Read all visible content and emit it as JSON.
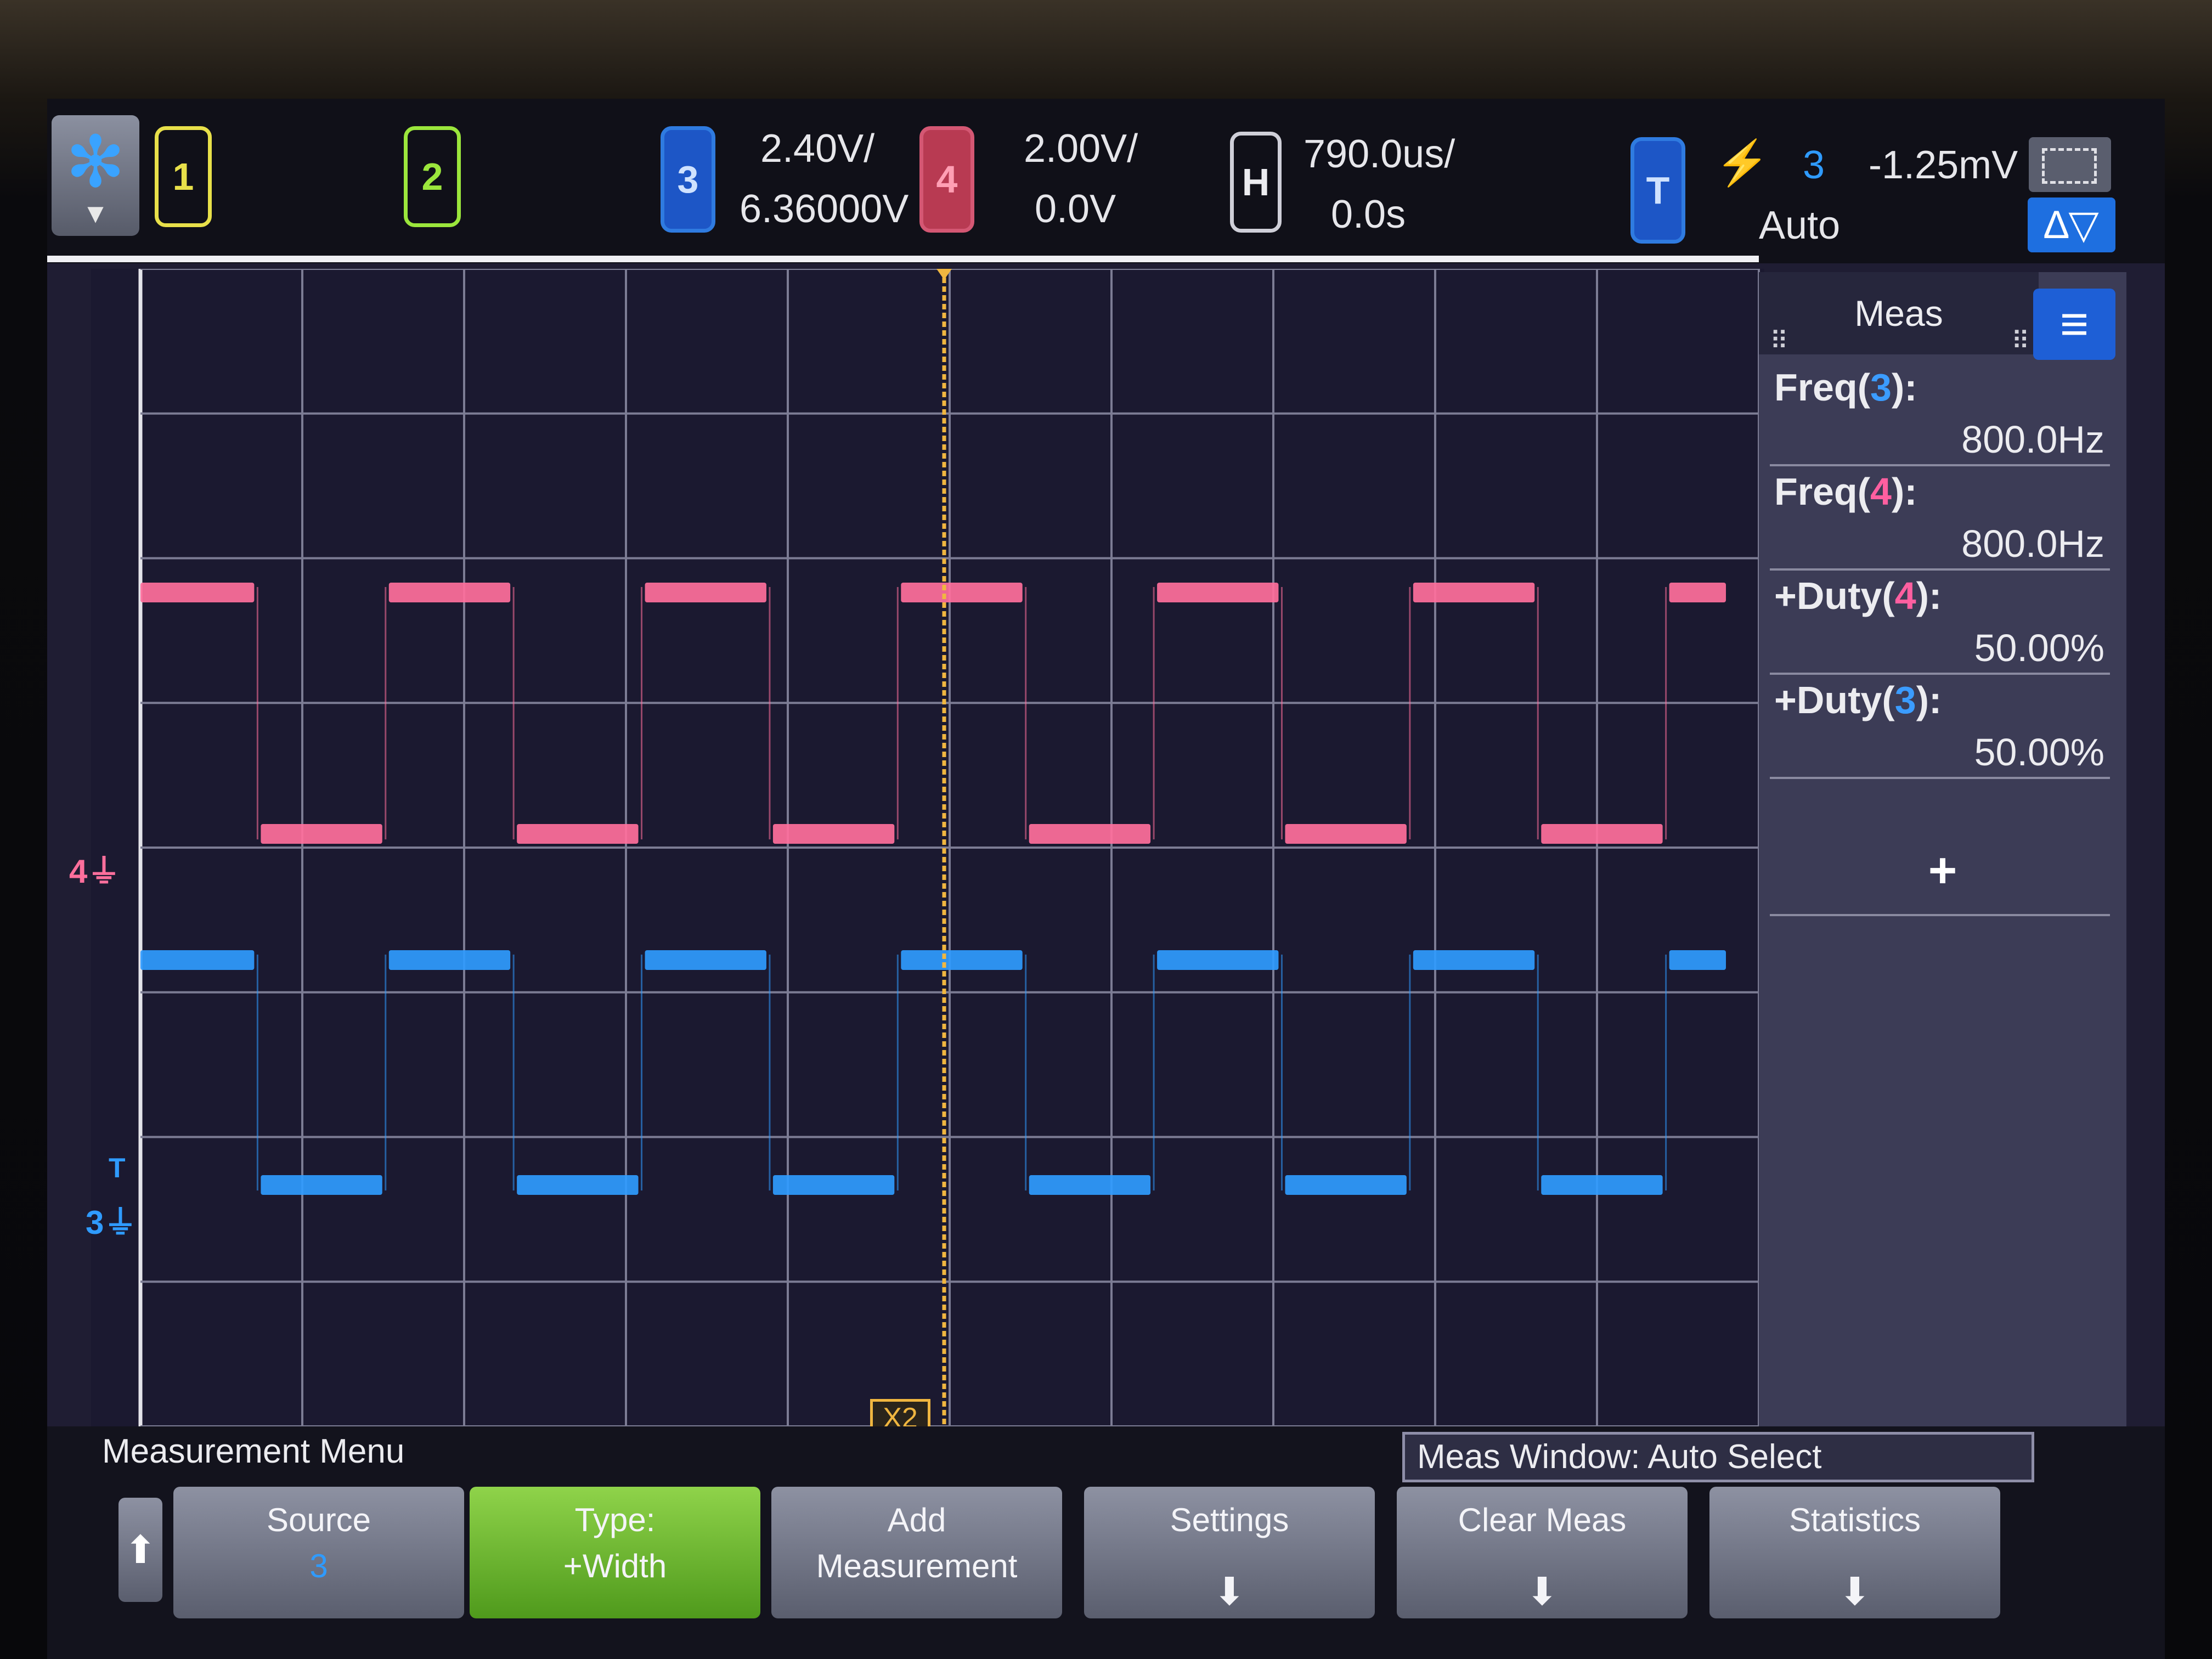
{
  "top_bar": {
    "run_icon": "snowflake-icon",
    "channel1_label": "1",
    "channel2_label": "2",
    "channel3_label": "3",
    "channel3_scale": "2.40V/",
    "channel3_offset": "6.36000V",
    "channel4_label": "4",
    "channel4_scale": "2.00V/",
    "channel4_offset": "0.0V",
    "horizontal_label": "H",
    "horizontal_scale": "790.0us/",
    "horizontal_delay": "0.0s",
    "trigger_label": "T",
    "trigger_slope_icon": "rising-edge-icon",
    "trigger_source": "3",
    "trigger_level": "-1.25mV",
    "trigger_mode": "Auto"
  },
  "markers": {
    "ch4_ground_label": "4",
    "ch3_ground_label": "3",
    "trigger_marker": "T",
    "cursor_label": "X2"
  },
  "measurements": {
    "header": "Meas",
    "items": [
      {
        "name": "Freq(",
        "channel": "3",
        "suffix": "):",
        "value": "800.0Hz"
      },
      {
        "name": "Freq(",
        "channel": "4",
        "suffix": "):",
        "value": "800.0Hz"
      },
      {
        "name": "+Duty(",
        "channel": "4",
        "suffix": "):",
        "value": "50.00%"
      },
      {
        "name": "+Duty(",
        "channel": "3",
        "suffix": "):",
        "value": "50.00%"
      }
    ],
    "add_symbol": "+"
  },
  "menu": {
    "title": "Measurement Menu",
    "meas_window": "Meas Window: Auto Select",
    "softkeys": [
      {
        "l1": "Source",
        "l2": "3"
      },
      {
        "l1": "Type:",
        "l2": "+Width"
      },
      {
        "l1": "Add",
        "l2": "Measurement"
      },
      {
        "l1": "Settings",
        "l2": ""
      },
      {
        "l1": "Clear Meas",
        "l2": ""
      },
      {
        "l1": "Statistics",
        "l2": ""
      }
    ]
  },
  "colors": {
    "channel1": "#e8e04a",
    "channel2": "#9be63c",
    "channel3": "#2f9bff",
    "channel4": "#ff6f9c",
    "cursor": "#f0b640"
  },
  "waveforms": {
    "horizontal_divisions": 10,
    "vertical_divisions": 8,
    "cycles_visible": 6.32,
    "duty": 0.5
  }
}
